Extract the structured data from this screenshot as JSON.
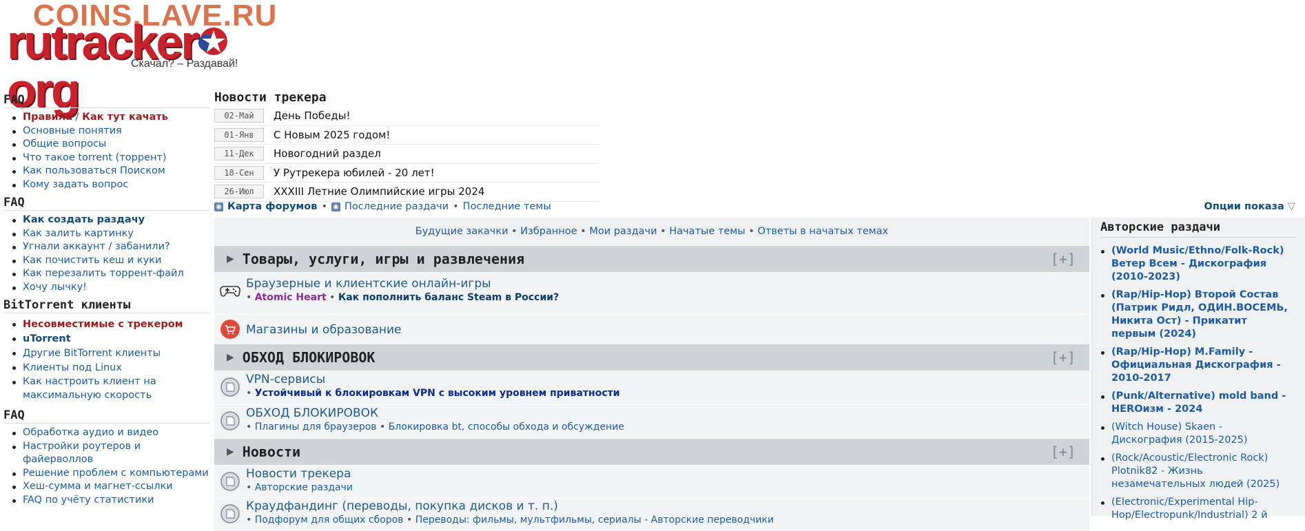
{
  "header": {
    "watermark": "COINS.LAVE.RU",
    "logo_text": "rutracker",
    "logo_suffix": "org",
    "tagline": "Скачал? – Раздавай!"
  },
  "sidebar": {
    "sections": [
      {
        "title": "FAQ",
        "items": [
          {
            "label_a": "Правила",
            "sep": " / ",
            "label_b": "Как тут качать",
            "style": "red"
          },
          {
            "label": "Основные понятия"
          },
          {
            "label": "Общие вопросы"
          },
          {
            "label": "Что такое torrent (торрент)"
          },
          {
            "label": "Как пользоваться Поиском"
          },
          {
            "label": "Кому задать вопрос"
          }
        ]
      },
      {
        "title": "FAQ",
        "items": [
          {
            "label": "Как создать раздачу",
            "style": "bold"
          },
          {
            "label": "Как залить картинку"
          },
          {
            "label": "Угнали аккаунт / забанили?"
          },
          {
            "label": "Как почистить кеш и куки"
          },
          {
            "label": "Как перезалить торрент-файл"
          },
          {
            "label": "Хочу лычку!"
          }
        ]
      },
      {
        "title": "BitTorrent клиенты",
        "items": [
          {
            "label": "Несовместимые с трекером",
            "style": "red"
          },
          {
            "label": "uTorrent",
            "style": "bold"
          },
          {
            "label": "Другие BitTorrent клиенты"
          },
          {
            "label": "Клиенты под Linux"
          },
          {
            "label": "Как настроить клиент на максимальную скорость"
          }
        ]
      },
      {
        "title": "FAQ",
        "items": [
          {
            "label": "Обработка аудио и видео"
          },
          {
            "label": "Настройки роутеров и файерволлов"
          },
          {
            "label": "Решение проблем с компьютерами"
          },
          {
            "label": "Хеш-сумма и магнет-ссылки"
          },
          {
            "label": "FAQ по учёту статистики"
          }
        ]
      }
    ]
  },
  "news": {
    "title": "Новости трекера",
    "items": [
      {
        "date": "02-Май",
        "text": "День Победы!"
      },
      {
        "date": "01-Янв",
        "text": "С Новым 2025 годом!"
      },
      {
        "date": "11-Дек",
        "text": "Новогодний раздел"
      },
      {
        "date": "18-Сен",
        "text": "У Рутрекера юбилей - 20 лет!"
      },
      {
        "date": "26-Июл",
        "text": "XXXIII Летние Олимпийские игры 2024"
      }
    ]
  },
  "links": {
    "forum_map": "Карта форумов",
    "latest_releases": "Последние раздачи",
    "latest_topics": "Последние темы",
    "sep": "•",
    "options": "Опции показа"
  },
  "quick_links": [
    "Будущие закачки",
    "Избранное",
    "Мои раздачи",
    "Начатые темы",
    "Ответы в начатых темах"
  ],
  "categories": [
    {
      "title": "Товары, услуги, игры и развлечения",
      "plus": "[+]",
      "forums": [
        {
          "icon": "gamepad-icon",
          "title": "Браузерные и клиентские онлайн-игры",
          "sub_a": "Atomic Heart",
          "sub_b": "Как пополнить баланс Steam в России?"
        },
        {
          "icon": "cart-icon",
          "title": "Магазины и образование"
        }
      ]
    },
    {
      "title": "ОБХОД БЛОКИРОВОК",
      "plus": "[+]",
      "forums": [
        {
          "icon": "forum-icon",
          "title": "VPN-сервисы",
          "sub_a": "Устойчивый к блокировкам VPN с высоким уровнем приватности"
        },
        {
          "icon": "forum-icon",
          "title": "ОБХОД БЛОКИРОВОК",
          "sub_a": "Плагины для браузеров",
          "sub_b": "Блокировка bt, способы обхода и обсуждение"
        }
      ]
    },
    {
      "title": "Новости",
      "plus": "[+]",
      "forums": [
        {
          "icon": "forum-icon",
          "title": "Новости трекера",
          "sub_a": "Авторские раздачи"
        },
        {
          "icon": "forum-icon",
          "title": "Краудфандинг (переводы, покупка дисков и т. п.)",
          "sub_a": "Подфорум для общих сборов",
          "sub_b": "Переводы: фильмы, мультфильмы, сериалы - Авторские переводчики"
        }
      ]
    }
  ],
  "right_panel": {
    "title": "Авторские раздачи",
    "items": [
      {
        "text": "(World Music/Ethno/Folk-Rock) Ветер Всем - Дискография (2010-2023)",
        "bold": true
      },
      {
        "text": "(Rap/Hip-Hop) Второй Состав (Патрик Ридл, ОДИН.ВОСЕМЬ, Никита Ост) - Прикатит первым (2024)",
        "bold": true
      },
      {
        "text": "(Rap/Hip-Hop) M.Family - Официальная Дискография - 2010-2017",
        "bold": true
      },
      {
        "text": "(Punk/Alternative) mold band - HEROизм - 2024",
        "bold": true
      },
      {
        "text": "(Witch House) Skaen - Дискография (2015-2025)",
        "bold": false
      },
      {
        "text": "(Rock/Acoustic/Electronic Rock) Plotnik82 - Жизнь незамечательных людей (2025)",
        "bold": false
      },
      {
        "text": "(Electronic/Experimental Hip-Hop/Electropunk/Industrial) 2 й",
        "bold": false
      }
    ]
  },
  "colors": {
    "accent": "#1e5a8a",
    "red": "#9b1e1e",
    "category_bg": "#cfd3d8"
  }
}
